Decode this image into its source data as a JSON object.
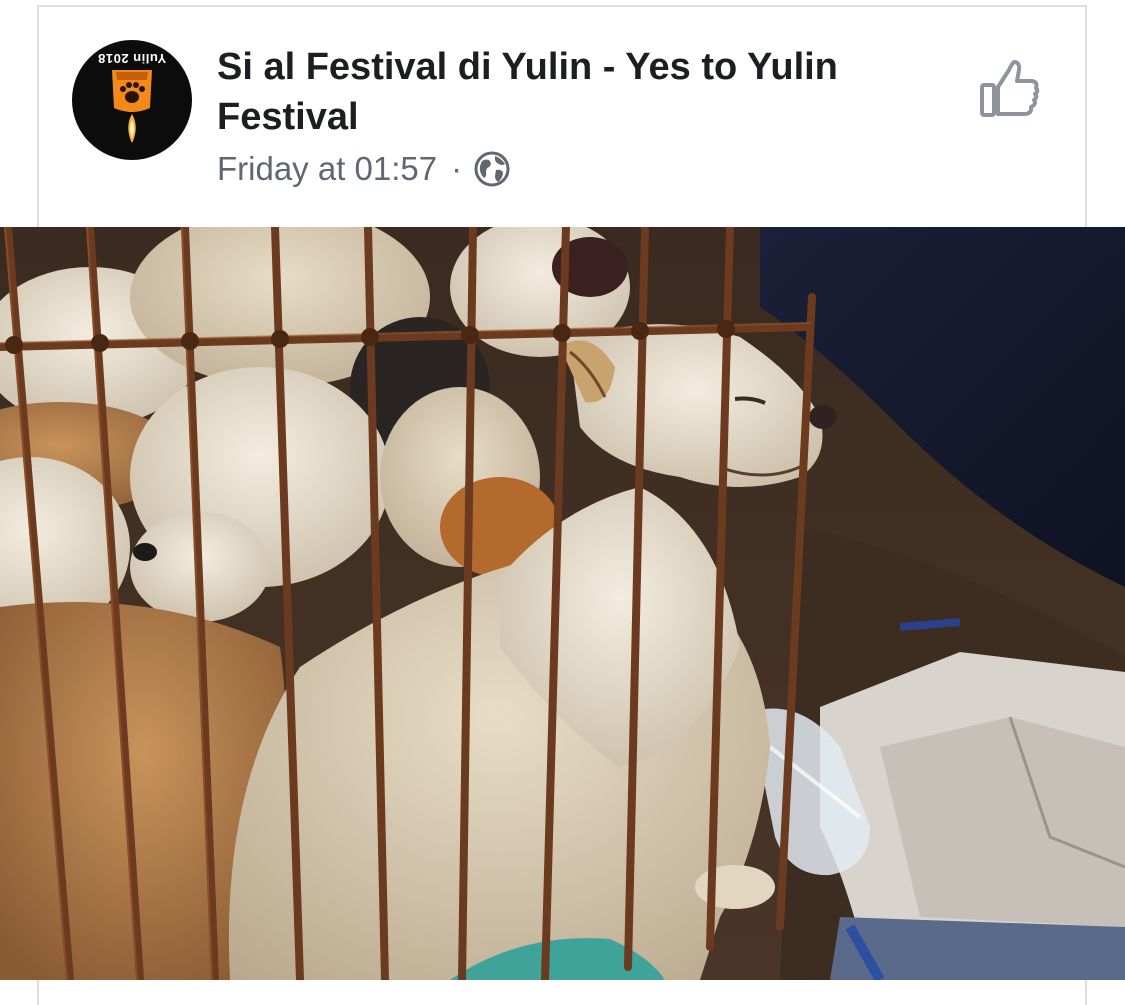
{
  "post": {
    "page_name": "Si al Festival di Yulin - Yes to Yulin Festival",
    "timestamp": "Friday at 01:57",
    "separator": "·",
    "audience_icon": "globe-icon",
    "like_icon": "thumbs-up-icon"
  },
  "avatar": {
    "logo_text": "Yulin 2018",
    "colors": {
      "background": "#0c0c0c",
      "lantern": "#f28a1a",
      "flame": "#ffd166"
    }
  },
  "colors": {
    "title": "#1c1e21",
    "meta": "#606770",
    "border": "#dadde1",
    "icon_gray": "#8d949e"
  }
}
